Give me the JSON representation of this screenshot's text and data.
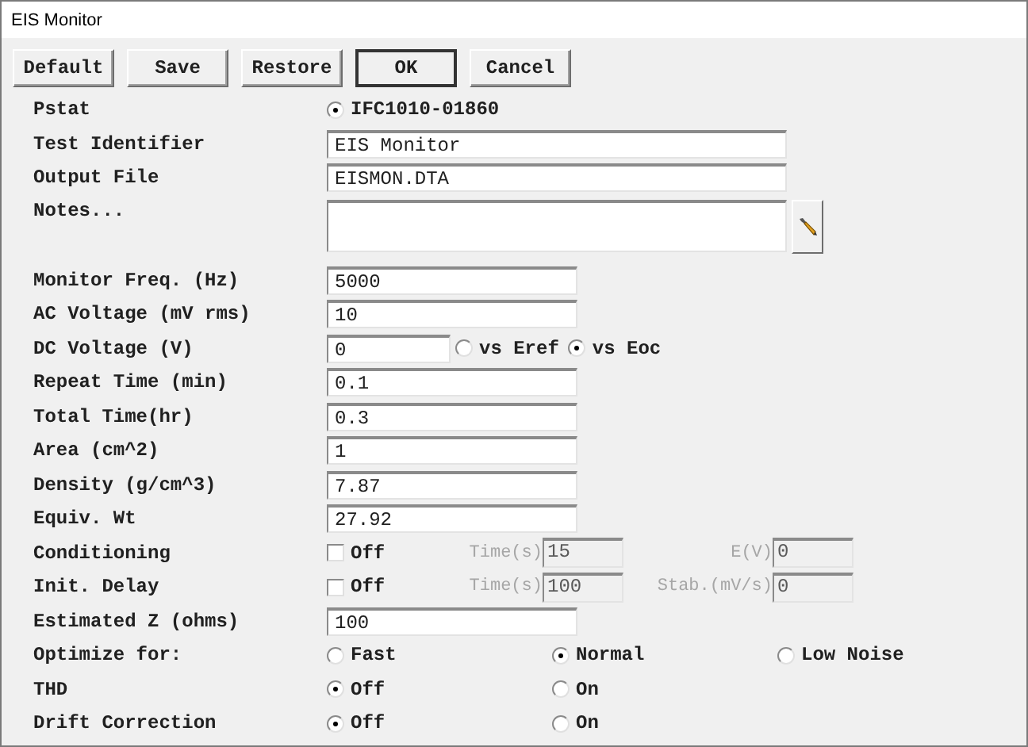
{
  "window": {
    "title": "EIS Monitor"
  },
  "buttons": [
    {
      "label": "Default",
      "default": false
    },
    {
      "label": "Save",
      "default": false
    },
    {
      "label": "Restore",
      "default": false
    },
    {
      "label": "OK",
      "default": true
    },
    {
      "label": "Cancel",
      "default": false
    }
  ],
  "rows": [
    {
      "kind": "radio",
      "label": "Pstat",
      "options": [
        {
          "label": "IFC1010-01860",
          "selected": true
        }
      ]
    },
    {
      "kind": "wide_text",
      "label": "Test Identifier",
      "value": "EIS Monitor"
    },
    {
      "kind": "wide_text",
      "label": "Output File",
      "value": "EISMON.DTA"
    },
    {
      "kind": "notes",
      "label": "Notes..."
    },
    {
      "kind": "text",
      "label": "Monitor Freq. (Hz)",
      "value": "5000"
    },
    {
      "kind": "text",
      "label": "AC Voltage (mV rms)",
      "value": "10"
    },
    {
      "kind": "voltage",
      "label": "DC Voltage (V)",
      "value": "0",
      "options": [
        {
          "label": "vs Eref",
          "selected": false
        },
        {
          "label": "vs Eoc",
          "selected": true
        }
      ]
    },
    {
      "kind": "text",
      "label": "Repeat Time (min)",
      "value": "0.1"
    },
    {
      "kind": "text",
      "label": "Total Time(hr)",
      "value": "0.3"
    },
    {
      "kind": "text",
      "label": "Area (cm^2)",
      "value": "1"
    },
    {
      "kind": "text",
      "label": "Density (g/cm^3)",
      "value": "7.87"
    },
    {
      "kind": "text",
      "label": "Equiv. Wt",
      "value": "27.92"
    },
    {
      "kind": "toggle",
      "label": "Conditioning",
      "checked": false,
      "check_label": "Off",
      "disabled": true,
      "params": [
        {
          "label": "Time(s)",
          "value": "15"
        },
        {
          "label": "E(V)",
          "value": "0"
        }
      ]
    },
    {
      "kind": "toggle",
      "label": "Init. Delay",
      "checked": false,
      "check_label": "Off",
      "disabled": true,
      "params": [
        {
          "label": "Time(s)",
          "value": "100"
        },
        {
          "label": "Stab.(mV/s)",
          "value": "0"
        }
      ]
    },
    {
      "kind": "text",
      "label": "Estimated Z (ohms)",
      "value": "100"
    },
    {
      "kind": "radio",
      "label": "Optimize for:",
      "options": [
        {
          "label": "Fast",
          "selected": false
        },
        {
          "label": "Normal",
          "selected": true
        },
        {
          "label": "Low Noise",
          "selected": false
        }
      ]
    },
    {
      "kind": "radio",
      "label": "THD",
      "options": [
        {
          "label": "Off",
          "selected": true
        },
        {
          "label": "On",
          "selected": false
        }
      ]
    },
    {
      "kind": "radio",
      "label": "Drift Correction",
      "options": [
        {
          "label": "Off",
          "selected": true
        },
        {
          "label": "On",
          "selected": false
        }
      ]
    }
  ]
}
